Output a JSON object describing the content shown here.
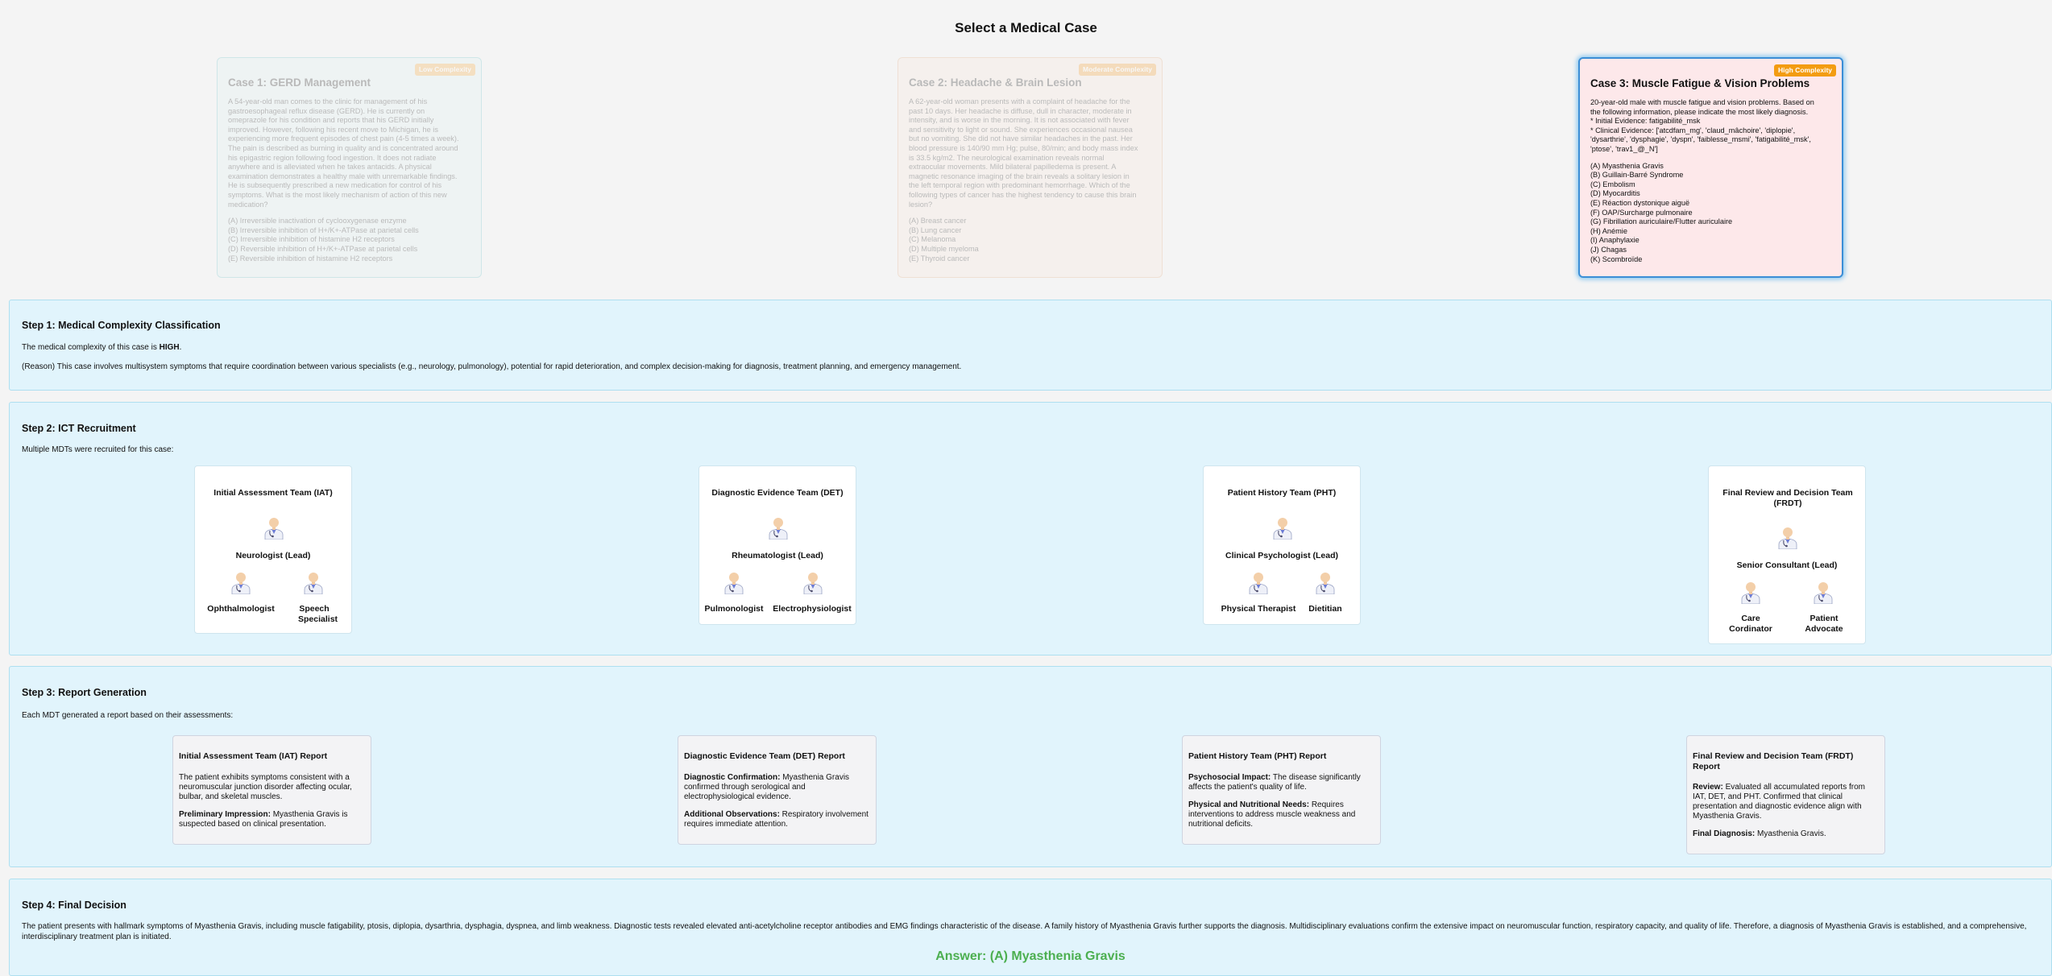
{
  "page_title": "Select a Medical Case",
  "cases": [
    {
      "badge": "Low Complexity",
      "title": "Case 1: GERD Management",
      "description": "A 54-year-old man comes to the clinic for management of his\ngastroesophageal reflux disease (GERD). He is currently on\nomeprazole for his condition and reports that his GERD initially\nimproved. However, following his recent move to Michigan, he is\nexperiencing more frequent episodes of chest pain (4-5 times a week).\nThe pain is described as burning in quality and is concentrated around\nhis epigastric region following food ingestion. It does not radiate\nanywhere and is alleviated when he takes antacids. A physical\nexamination demonstrates a healthy male with unremarkable findings.\nHe is subsequently prescribed a new medication for control of his\nsymptoms. What is the most likely mechanism of action of this new\nmedication?",
      "options": "(A) Irreversible inactivation of cyclooxygenase enzyme\n(B) Irreversible inhibition of H+/K+-ATPase at parietal cells\n(C) Irreversible inhibition of histamine H2 receptors\n(D) Reversible inhibition of H+/K+-ATPase at parietal cells\n(E) Reversible inhibition of histamine H2 receptors"
    },
    {
      "badge": "Moderate Complexity",
      "title": "Case 2: Headache & Brain Lesion",
      "description": "A 62-year-old woman presents with a complaint of headache for the\npast 10 days. Her headache is diffuse, dull in character, moderate in\nintensity, and is worse in the morning. It is not associated with fever\nand sensitivity to light or sound. She experiences occasional nausea\nbut no vomiting. She did not have similar headaches in the past. Her\nblood pressure is 140/90 mm Hg; pulse, 80/min; and body mass index\nis 33.5 kg/m2. The neurological examination reveals normal\nextraocular movements. Mild bilateral papilledema is present. A\nmagnetic resonance imaging of the brain reveals a solitary lesion in\nthe left temporal region with predominant hemorrhage. Which of the\nfollowing types of cancer has the highest tendency to cause this brain\nlesion?",
      "options": "(A) Breast cancer\n(B) Lung cancer\n(C) Melanoma\n(D) Multiple myeloma\n(E) Thyroid cancer"
    },
    {
      "badge": "High Complexity",
      "title": "Case 3: Muscle Fatigue & Vision Problems",
      "description": "20-year-old male with muscle fatigue and vision problems. Based on\nthe following information, please indicate the most likely diagnosis.\n* Initial Evidence: fatigabilité_msk\n* Clinical Evidence: ['atcdfam_mg', 'claud_mâchoire', 'diplopie',\n'dysarthrie', 'dysphagie', 'dyspn', 'faiblesse_msmi', 'fatigabilité_msk',\n'ptose', 'trav1_@_N']",
      "options": "(A) Myasthenia Gravis\n(B) Guillain-Barré Syndrome\n(C) Embolism\n(D) Myocarditis\n(E) Réaction dystonique aiguë\n(F) OAP/Surcharge pulmonaire\n(G) Fibrillation auriculaire/Flutter auriculaire\n(H) Anémie\n(I) Anaphylaxie\n(J) Chagas\n(K) Scombroïde"
    }
  ],
  "step1": {
    "title": "Step 1: Medical Complexity Classification",
    "line_prefix": "The medical complexity of this case is ",
    "level": "HIGH",
    "line_suffix": ".",
    "reason": "(Reason) This case involves multisystem symptoms that require coordination between various specialists (e.g., neurology, pulmonology), potential for rapid deterioration, and complex decision-making for diagnosis, treatment planning, and emergency management."
  },
  "step2": {
    "title": "Step 2: ICT Recruitment",
    "subtitle": "Multiple MDTs were recruited for this case:",
    "teams": [
      {
        "name": "Initial Assessment Team (IAT)",
        "lead": "Neurologist (Lead)",
        "members": [
          "Ophthalmologist",
          "Speech Specialist"
        ]
      },
      {
        "name": "Diagnostic Evidence Team (DET)",
        "lead": "Rheumatologist (Lead)",
        "members": [
          "Pulmonologist",
          "Electrophysiologist"
        ]
      },
      {
        "name": "Patient History Team (PHT)",
        "lead": "Clinical Psychologist (Lead)",
        "members": [
          "Physical Therapist",
          "Dietitian"
        ]
      },
      {
        "name": "Final Review and Decision Team (FRDT)",
        "lead": "Senior Consultant (Lead)",
        "members": [
          "Care Cordinator",
          "Patient Advocate"
        ]
      }
    ]
  },
  "step3": {
    "title": "Step 3: Report Generation",
    "subtitle": "Each MDT generated a report based on their assessments:",
    "reports": [
      {
        "title": "Initial Assessment Team (IAT) Report",
        "paragraphs": [
          {
            "label": "",
            "text": "The patient exhibits symptoms consistent with a neuromuscular junction disorder affecting ocular, bulbar, and skeletal muscles."
          },
          {
            "label": "Preliminary Impression:",
            "text": " Myasthenia Gravis is suspected based on clinical presentation."
          }
        ]
      },
      {
        "title": "Diagnostic Evidence Team (DET) Report",
        "paragraphs": [
          {
            "label": "Diagnostic Confirmation:",
            "text": " Myasthenia Gravis confirmed through serological and electrophysiological evidence."
          },
          {
            "label": "Additional Observations:",
            "text": " Respiratory involvement requires immediate attention."
          }
        ]
      },
      {
        "title": "Patient History Team (PHT) Report",
        "paragraphs": [
          {
            "label": "Psychosocial Impact:",
            "text": " The disease significantly affects the patient's quality of life."
          },
          {
            "label": "Physical and Nutritional Needs:",
            "text": " Requires interventions to address muscle weakness and nutritional deficits."
          }
        ]
      },
      {
        "title": "Final Review and Decision Team (FRDT) Report",
        "paragraphs": [
          {
            "label": "Review:",
            "text": " Evaluated all accumulated reports from IAT, DET, and PHT. Confirmed that clinical presentation and diagnostic evidence align with Myasthenia Gravis."
          },
          {
            "label": "Final Diagnosis:",
            "text": " Myasthenia Gravis."
          }
        ]
      }
    ]
  },
  "step4": {
    "title": "Step 4: Final Decision",
    "text": "The patient presents with hallmark symptoms of Myasthenia Gravis, including muscle fatigability, ptosis, diplopia, dysarthria, dysphagia, dyspnea, and limb weakness. Diagnostic tests revealed elevated anti-acetylcholine receptor antibodies and EMG findings characteristic of the disease. A family history of Myasthenia Gravis further supports the diagnosis. Multidisciplinary evaluations confirm the extensive impact on neuromuscular function, respiratory capacity, and quality of life. Therefore, a diagnosis of Myasthenia Gravis is established, and a comprehensive, interdisciplinary treatment plan is initiated.",
    "answer": "Answer: (A) Myasthenia Gravis"
  },
  "colors": {
    "answer_green": "#4caf50",
    "step_background": "#e1f4fc",
    "selected_case_border": "#3b8ed6",
    "high_badge": "#f39c12"
  },
  "icons": {
    "team_member": "doctor-avatar-icon"
  }
}
